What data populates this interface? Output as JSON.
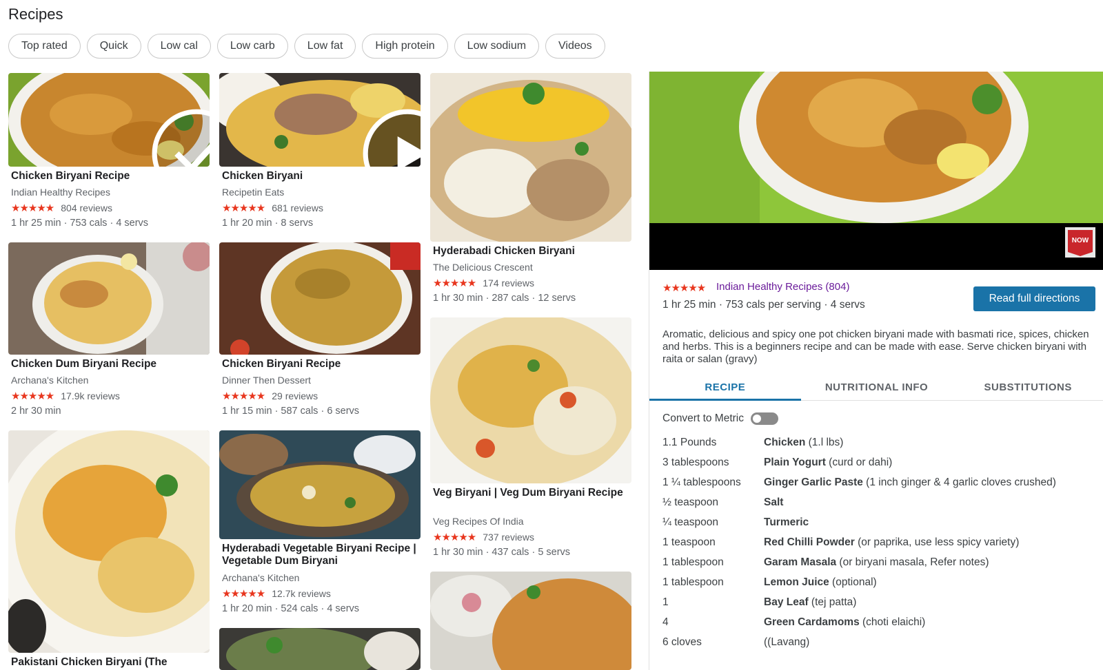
{
  "page_title": "Recipes",
  "filters": [
    "Top rated",
    "Quick",
    "Low cal",
    "Low carb",
    "Low fat",
    "High protein",
    "Low sodium",
    "Videos"
  ],
  "cards": [
    {
      "title": "Chicken Biryani Recipe",
      "source": "Indian Healthy Recipes",
      "stars": "★★★★★",
      "reviews": "804 reviews",
      "meta": "1 hr 25 min · 753 cals · 4 servs",
      "badge": "check"
    },
    {
      "title": "Chicken Biryani",
      "source": "Recipetin Eats",
      "stars": "★★★★★",
      "reviews": "681 reviews",
      "meta": "1 hr 20 min · 8 servs",
      "badge": "play"
    },
    {
      "title": "Hyderabadi Chicken Biryani",
      "source": "The Delicious Crescent",
      "stars": "★★★★★",
      "reviews": "174 reviews",
      "meta": "1 hr 30 min · 287 cals · 12 servs"
    },
    {
      "title": "Chicken Dum Biryani Recipe",
      "source": "Archana's Kitchen",
      "stars": "★★★★★",
      "reviews": "17.9k reviews",
      "meta": "2 hr 30 min"
    },
    {
      "title": "Chicken Biryani Recipe",
      "source": "Dinner Then Dessert",
      "stars": "★★★★★",
      "reviews": "29 reviews",
      "meta": "1 hr 15 min · 587 cals · 6 servs"
    },
    {
      "title": "Veg Biryani | Veg Dum Biryani Recipe",
      "source": "Veg Recipes Of India",
      "stars": "★★★★★",
      "reviews": "737 reviews",
      "meta": "1 hr 30 min · 437 cals · 5 servs"
    },
    {
      "title": "Pakistani Chicken Biryani (The"
    },
    {
      "title": "Hyderabadi Vegetable Biryani Recipe | Vegetable Dum Biryani",
      "source": "Archana's Kitchen",
      "stars": "★★★★★",
      "reviews": "12.7k reviews",
      "meta": "1 hr 20 min · 524 cals · 4 servs"
    }
  ],
  "panel": {
    "stars": "★★★★★",
    "source": "Indian Healthy Recipes (804)",
    "meta": "1 hr 25 min · 753 cals per serving · 4 servs",
    "read_button": "Read full directions",
    "description": "Aromatic, delicious and spicy one pot chicken biryani made with basmati rice, spices, chicken and herbs. This is a beginners recipe and can be made with ease. Serve chicken biryani with raita or salan (gravy)",
    "tabs": [
      "RECIPE",
      "NUTRITIONAL INFO",
      "SUBSTITUTIONS"
    ],
    "active_tab": "RECIPE",
    "metric_label": "Convert to Metric",
    "metric_on": false,
    "subscribe_text": "NOW",
    "ingredients": [
      {
        "qty": "1.1 Pounds",
        "name": "Chicken",
        "note": " (1.l lbs)"
      },
      {
        "qty": "3 tablespoons",
        "name": "Plain Yogurt",
        "note": " (curd or dahi)"
      },
      {
        "qty": "1 ¼ tablespoons",
        "name": "Ginger Garlic Paste",
        "note": " (1 inch ginger & 4 garlic cloves crushed)"
      },
      {
        "qty": "½ teaspoon",
        "name": "Salt",
        "note": ""
      },
      {
        "qty": "¼ teaspoon",
        "name": "Turmeric",
        "note": ""
      },
      {
        "qty": "1 teaspoon",
        "name": "Red Chilli Powder",
        "note": " (or paprika, use less spicy variety)"
      },
      {
        "qty": "1 tablespoon",
        "name": "Garam Masala",
        "note": " (or biryani masala, Refer notes)"
      },
      {
        "qty": "1 tablespoon",
        "name": "Lemon Juice",
        "note": " (optional)"
      },
      {
        "qty": "1",
        "name": "Bay Leaf",
        "note": " (tej patta)"
      },
      {
        "qty": "4",
        "name": "Green Cardamoms",
        "note": " (choti elaichi)"
      },
      {
        "qty": "6 cloves",
        "name": "",
        "note": "((Lavang)"
      }
    ]
  }
}
